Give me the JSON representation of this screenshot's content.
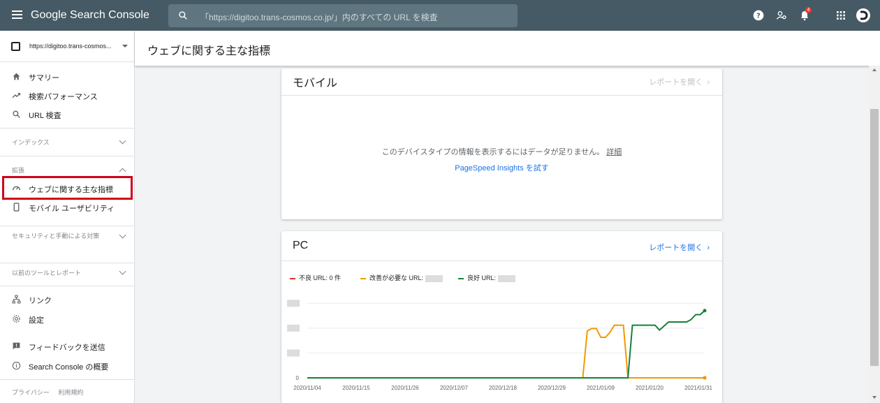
{
  "app": {
    "name": "Google Search Console"
  },
  "search": {
    "placeholder": "「https://digitoo.trans-cosmos.co.jp/」内のすべての URL を検査"
  },
  "notifications": {
    "count": "4"
  },
  "property": {
    "url": "https://digitoo.trans-cosmos..."
  },
  "sidebar": {
    "summary": "サマリー",
    "performance": "検索パフォーマンス",
    "url_inspect": "URL 検査",
    "index_section": "インデックス",
    "ext_section": "拡張",
    "cwv": "ウェブに関する主な指標",
    "mobile_usability": "モバイル ユーザビリティ",
    "security_section": "セキュリティと手動による対策",
    "legacy_section": "以前のツールとレポート",
    "links": "リンク",
    "settings": "設定",
    "feedback": "フィードバックを送信",
    "about": "Search Console の概要",
    "privacy": "プライバシー",
    "terms": "利用規約"
  },
  "page": {
    "title": "ウェブに関する主な指標"
  },
  "mobile_card": {
    "title": "モバイル",
    "open_report": "レポートを開く",
    "message": "このデバイスタイプの情報を表示するにはデータが足りません。",
    "details": "詳細",
    "psi_link": "PageSpeed Insights を試す"
  },
  "pc_card": {
    "title": "PC",
    "open_report": "レポートを開く",
    "legend_poor": "不良 URL: 0 件",
    "legend_ni": "改善が必要な URL:",
    "legend_good": "良好 URL:"
  },
  "colors": {
    "poor": "#d93025",
    "needs_improvement": "#f29900",
    "good": "#188038",
    "link": "#1a73e8"
  },
  "chart_data": {
    "type": "line",
    "x_ticks": [
      "2020/11/04",
      "2020/11/15",
      "2020/11/26",
      "2020/12/07",
      "2020/12/18",
      "2020/12/29",
      "2021/01/09",
      "2021/01/20",
      "2021/01/31"
    ],
    "y_ticks": [
      "0"
    ],
    "series": [
      {
        "name": "不良 URL",
        "color": "#d93025",
        "points": [
          [
            0,
            0
          ],
          [
            88,
            0
          ]
        ]
      },
      {
        "name": "改善が必要な URL",
        "color": "#f29900",
        "points": [
          [
            0,
            0
          ],
          [
            61,
            0
          ],
          [
            62,
            0.58
          ],
          [
            63,
            0.61
          ],
          [
            64,
            0.61
          ],
          [
            65,
            0.5
          ],
          [
            66,
            0.5
          ],
          [
            67,
            0.56
          ],
          [
            68,
            0.65
          ],
          [
            69,
            0.65
          ],
          [
            70,
            0.65
          ],
          [
            71,
            0
          ],
          [
            88,
            0
          ]
        ]
      },
      {
        "name": "良好 URL",
        "color": "#188038",
        "points": [
          [
            0,
            0
          ],
          [
            71,
            0
          ],
          [
            72,
            0.65
          ],
          [
            73,
            0.65
          ],
          [
            74,
            0.65
          ],
          [
            75,
            0.65
          ],
          [
            76,
            0.65
          ],
          [
            77,
            0.65
          ],
          [
            78,
            0.59
          ],
          [
            79,
            0.64
          ],
          [
            80,
            0.69
          ],
          [
            81,
            0.69
          ],
          [
            82,
            0.69
          ],
          [
            83,
            0.69
          ],
          [
            84,
            0.69
          ],
          [
            85,
            0.72
          ],
          [
            86,
            0.78
          ],
          [
            87,
            0.78
          ],
          [
            88,
            0.83
          ]
        ]
      }
    ]
  }
}
